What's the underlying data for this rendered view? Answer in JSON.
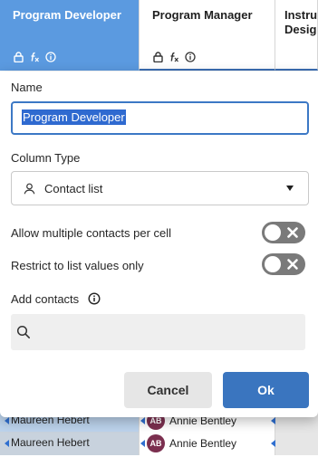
{
  "columns": [
    {
      "title": "Program Developer",
      "selected": true
    },
    {
      "title": "Program Manager",
      "selected": false
    },
    {
      "title": "Instru… Design",
      "line1": "Instru",
      "line2": "Desig"
    }
  ],
  "dialog": {
    "name_label": "Name",
    "name_value": "Program Developer",
    "column_type_label": "Column Type",
    "column_type_value": "Contact list",
    "allow_multiple_label": "Allow multiple contacts per cell",
    "allow_multiple_on": false,
    "restrict_label": "Restrict to list values only",
    "restrict_on": false,
    "add_contacts_label": "Add contacts",
    "search_placeholder": "",
    "cancel_label": "Cancel",
    "ok_label": "Ok"
  },
  "rows": [
    {
      "developer": "Maureen Hebert",
      "manager_initials": "AB",
      "manager": "Annie Bentley"
    },
    {
      "developer": "Maureen Hebert",
      "manager_initials": "AB",
      "manager": "Annie Bentley"
    }
  ],
  "colors": {
    "accent": "#3a75bf",
    "header_selected": "#5b9ae0",
    "avatar": "#7b2f4f",
    "toggle_off": "#7a7a7a"
  }
}
